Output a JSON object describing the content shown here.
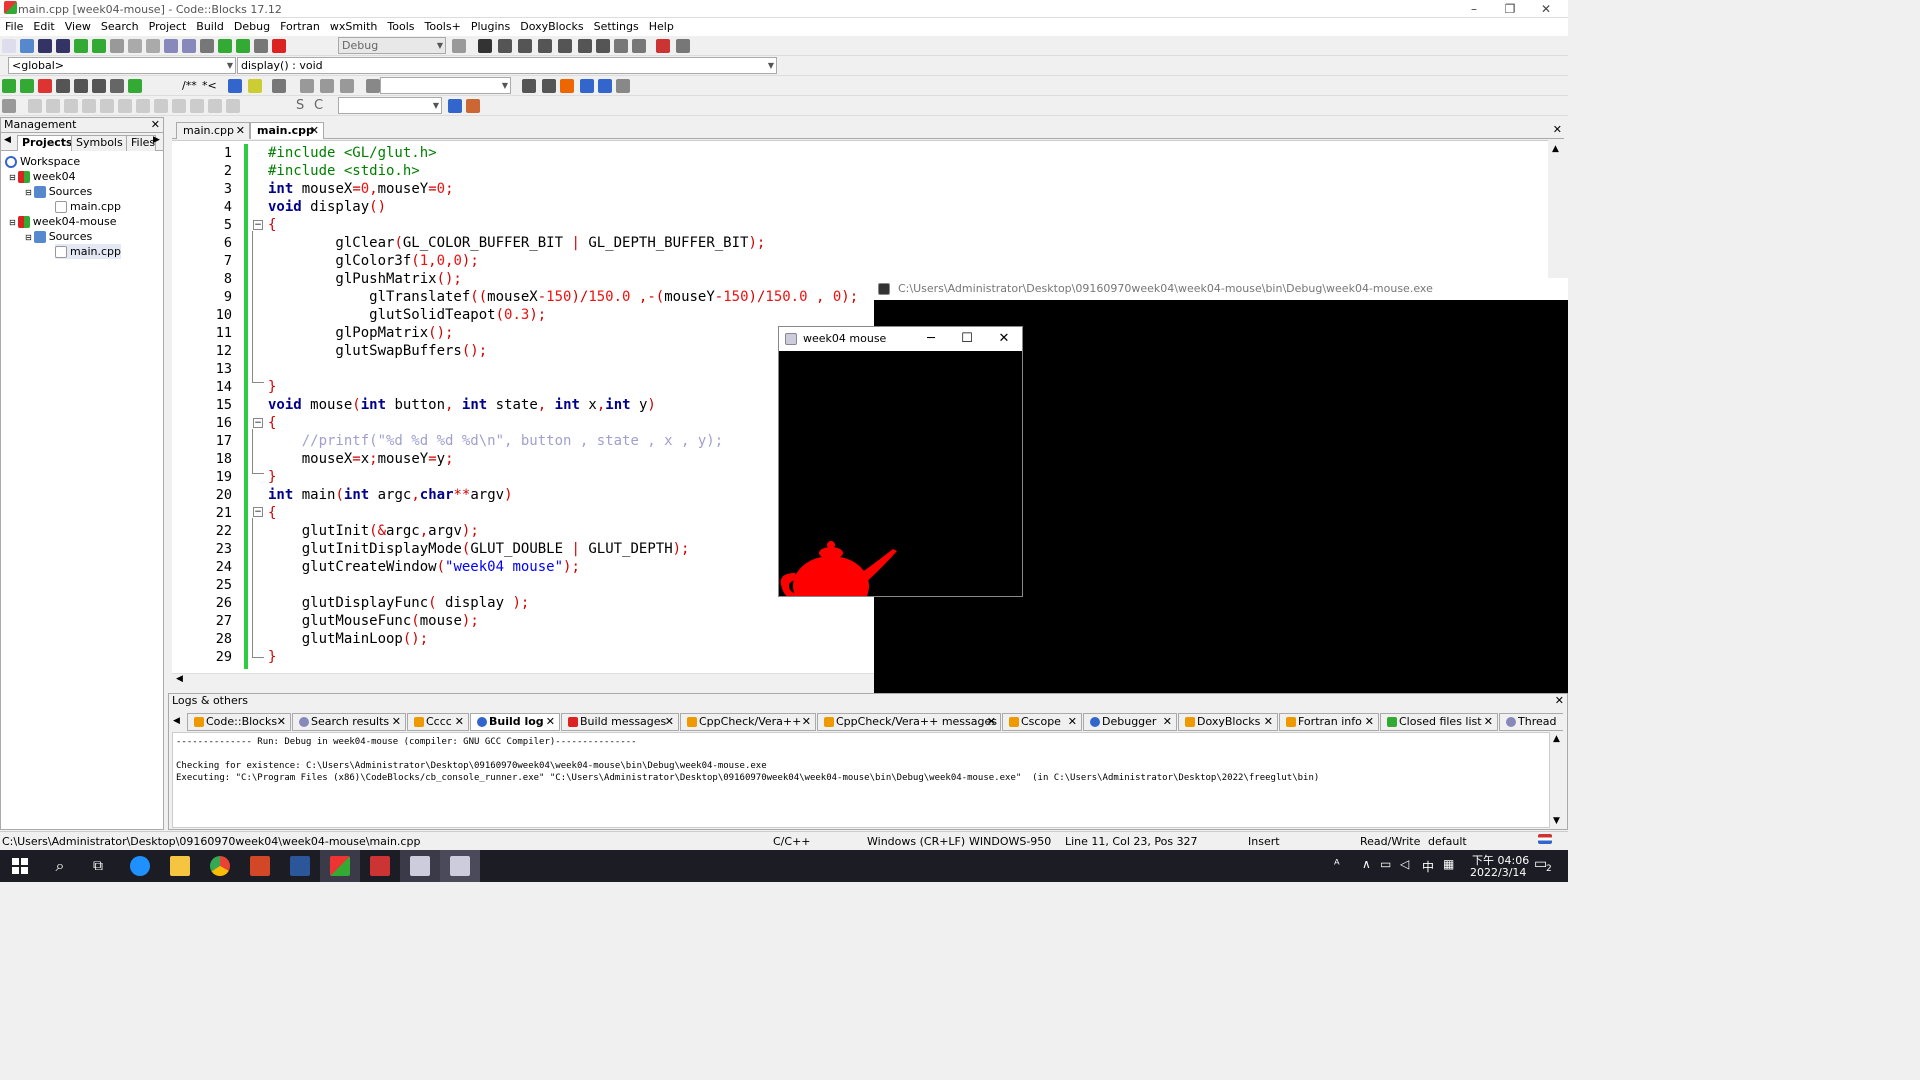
{
  "window": {
    "title": "main.cpp [week04-mouse] - Code::Blocks 17.12",
    "min": "–",
    "restore": "❐",
    "close": "✕"
  },
  "menu": [
    "File",
    "Edit",
    "View",
    "Search",
    "Project",
    "Build",
    "Debug",
    "Fortran",
    "wxSmith",
    "Tools",
    "Tools+",
    "Plugins",
    "DoxyBlocks",
    "Settings",
    "Help"
  ],
  "toolbar": {
    "build_target": "Debug",
    "scope": "<global>",
    "symbol": "display() : void",
    "search_value": "",
    "comment_a": "/**",
    "comment_b": "*<",
    "tb_s": "S",
    "tb_c": "C"
  },
  "management": {
    "title": "Management",
    "close": "✕",
    "tabs": [
      "Projects",
      "Symbols",
      "Files"
    ],
    "tree": [
      {
        "label": "Workspace"
      },
      {
        "label": "week04"
      },
      {
        "label": "Sources"
      },
      {
        "label": "main.cpp"
      },
      {
        "label": "week04-mouse"
      },
      {
        "label": "Sources"
      },
      {
        "label": "main.cpp"
      }
    ]
  },
  "editor": {
    "tabs": [
      "main.cpp",
      "main.cpp"
    ],
    "active_tab_index": 1,
    "line_numbers": [
      "1",
      "2",
      "3",
      "4",
      "5",
      "6",
      "7",
      "8",
      "9",
      "10",
      "11",
      "12",
      "13",
      "14",
      "15",
      "16",
      "17",
      "18",
      "19",
      "20",
      "21",
      "22",
      "23",
      "24",
      "25",
      "26",
      "27",
      "28",
      "29"
    ]
  },
  "console_window": {
    "title": "C:\\Users\\Administrator\\Desktop\\09160970week04\\week04-mouse\\bin\\Debug\\week04-mouse.exe"
  },
  "glut_window": {
    "title": "week04 mouse",
    "min": "─",
    "max": "☐",
    "close": "✕",
    "teapot_color": "#ff0000"
  },
  "logs": {
    "title": "Logs & others",
    "close": "✕",
    "tabs": [
      "Code::Blocks",
      "Search results",
      "Cccc",
      "Build log",
      "Build messages",
      "CppCheck/Vera++",
      "CppCheck/Vera++ messages",
      "Cscope",
      "Debugger",
      "DoxyBlocks",
      "Fortran info",
      "Closed files list",
      "Thread"
    ],
    "active_tab": "Build log",
    "text": "-------------- Run: Debug in week04-mouse (compiler: GNU GCC Compiler)---------------\n\nChecking for existence: C:\\Users\\Administrator\\Desktop\\09160970week04\\week04-mouse\\bin\\Debug\\week04-mouse.exe\nExecuting: \"C:\\Program Files (x86)\\CodeBlocks/cb_console_runner.exe\" \"C:\\Users\\Administrator\\Desktop\\09160970week04\\week04-mouse\\bin\\Debug\\week04-mouse.exe\"  (in C:\\Users\\Administrator\\Desktop\\2022\\freeglut\\bin)"
  },
  "status": {
    "path": "C:\\Users\\Administrator\\Desktop\\09160970week04\\week04-mouse\\main.cpp",
    "lang": "C/C++",
    "eol": "Windows (CR+LF)",
    "encoding": "WINDOWS-950",
    "position": "Line 11, Col 23, Pos 327",
    "mode": "Insert",
    "access": "Read/Write",
    "profile": "default"
  },
  "taskbar": {
    "time": "下午 04:06",
    "date": "2022/3/14",
    "ime": "中",
    "tray": "ᴬ",
    "notif": "2"
  }
}
